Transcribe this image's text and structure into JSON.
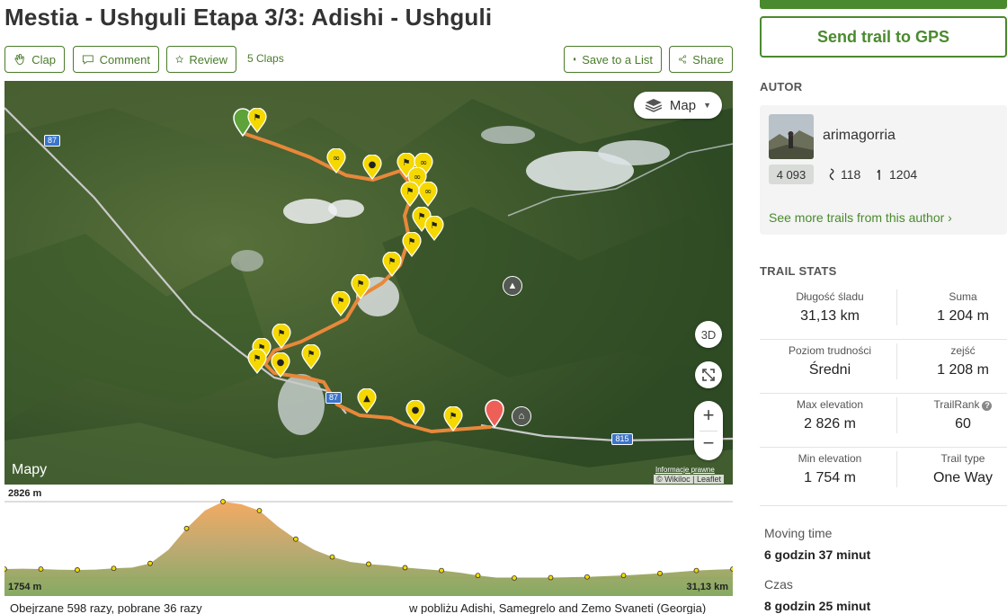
{
  "title": "Mestia - Ushguli Etapa 3/3: Adishi - Ushguli",
  "actions": {
    "clap": "Clap",
    "comment": "Comment",
    "review": "Review",
    "claps_count": "5 Claps",
    "save": "Save to a List",
    "share": "Share"
  },
  "map": {
    "type_label": "Map",
    "btn_3d": "3D",
    "zoom_in": "+",
    "zoom_out": "−",
    "brand": "Mapy",
    "legal": "Informacje prawne",
    "attribution": "© Wikiloc | Leaflet",
    "road_labels": [
      "87",
      "87",
      "815"
    ]
  },
  "elevation": {
    "max": "2826 m",
    "min": "1754 m",
    "distance": "31,13 km",
    "profile_m": [
      1880,
      1885,
      1880,
      1870,
      1868,
      1872,
      1890,
      1900,
      1960,
      2150,
      2450,
      2700,
      2826,
      2790,
      2700,
      2480,
      2300,
      2150,
      2050,
      1980,
      1950,
      1930,
      1900,
      1880,
      1860,
      1830,
      1790,
      1760,
      1754,
      1756,
      1760,
      1765,
      1770,
      1780,
      1790,
      1805,
      1820,
      1840,
      1860,
      1870,
      1880
    ]
  },
  "footer": {
    "views": "Obejrzane 598 razy, pobrane 36 razy",
    "location": "w pobliżu Adishi, Samegrelo and Zemo Svaneti (Georgia)"
  },
  "sidebar": {
    "gps_button": "Send trail to GPS",
    "author_title": "AUTOR",
    "author_name": "arimagorria",
    "author_rank": "4 093",
    "author_trails": "118",
    "author_followers": "1204",
    "more_link": "See more trails from this author ›",
    "stats_title": "TRAIL STATS",
    "stats": [
      {
        "left_label": "Długość śladu",
        "left_value": "31,13 km",
        "right_label": "Suma",
        "right_value": "1 204 m"
      },
      {
        "left_label": "Poziom trudności",
        "left_value": "Średni",
        "right_label": "zejść",
        "right_value": "1 208 m"
      },
      {
        "left_label": "Max elevation",
        "left_value": "2 826 m",
        "right_label": "TrailRank",
        "right_value": "60"
      },
      {
        "left_label": "Min elevation",
        "left_value": "1 754 m",
        "right_label": "Trail type",
        "right_value": "One Way"
      }
    ],
    "moving_label": "Moving time",
    "moving_value": "6 godzin 37 minut",
    "time_label": "Czas",
    "time_value": "8 godzin 25 minut"
  },
  "colors": {
    "brand_green": "#4a8a2e",
    "track": "#e8883a",
    "waypoint": "#f4d800",
    "start_pin": "#5ea23a",
    "end_pin": "#ee5f57"
  }
}
